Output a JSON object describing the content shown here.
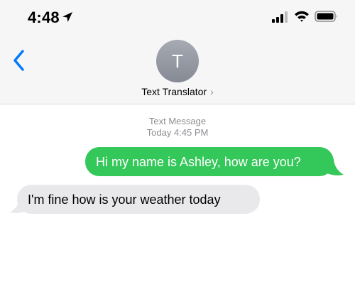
{
  "status_bar": {
    "time": "4:48"
  },
  "icons": {
    "location": "location-arrow-icon",
    "signal": "cellular-signal-icon",
    "wifi": "wifi-icon",
    "battery": "battery-icon",
    "back": "chevron-left-icon",
    "chevron": "chevron-right-icon"
  },
  "header": {
    "avatar_initial": "T",
    "contact_name": "Text Translator",
    "chevron": "›"
  },
  "thread": {
    "service_label": "Text Message",
    "timestamp": "Today 4:45 PM"
  },
  "messages": [
    {
      "direction": "sent",
      "text": "Hi my name is Ashley, how are you?"
    },
    {
      "direction": "received",
      "text": "I'm fine how is your weather today"
    }
  ],
  "colors": {
    "accent_blue": "#007aff",
    "sent_bubble": "#34c759",
    "received_bubble": "#e9e9eb",
    "header_bg": "#f6f6f6",
    "secondary_text": "#8e8e93"
  }
}
